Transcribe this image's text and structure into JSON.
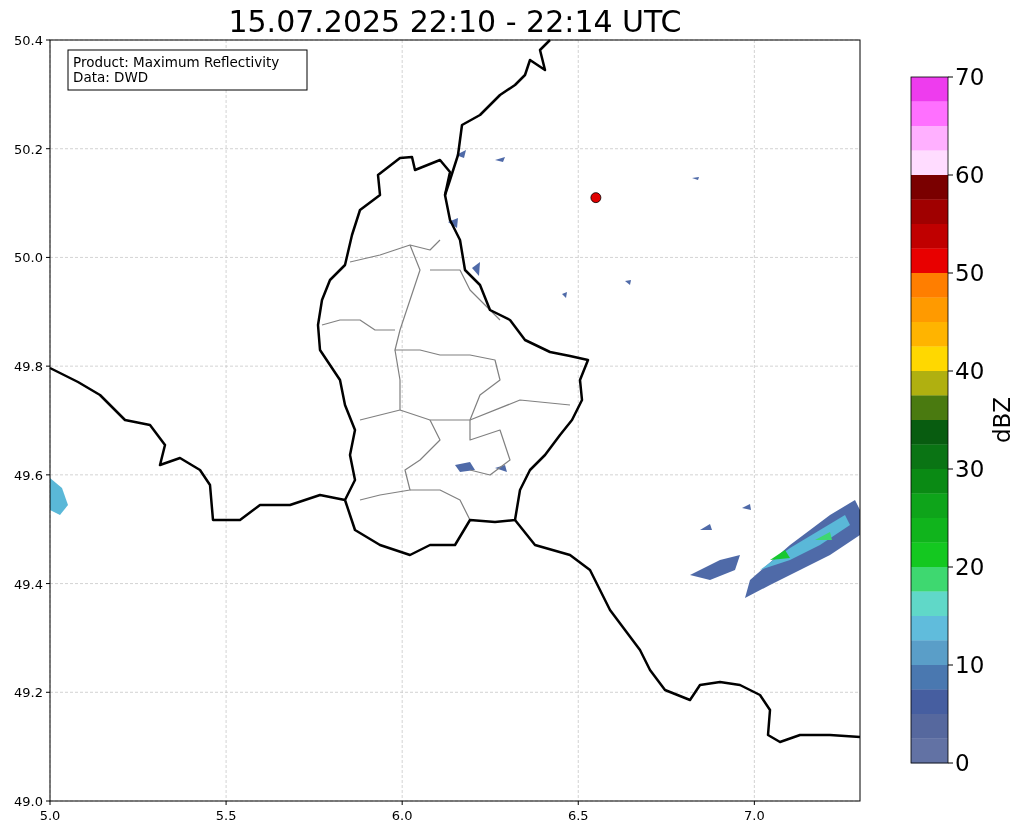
{
  "title": "15.07.2025 22:10 - 22:14 UTC",
  "info_box": {
    "lines": [
      "Product: Maximum Reflectivity",
      "Data: DWD"
    ]
  },
  "map": {
    "chart_data": {
      "type": "scatter",
      "grid": true,
      "xlim": [
        5.0,
        7.3
      ],
      "ylim": [
        49.0,
        50.4
      ],
      "xticks": [
        {
          "value": 5.0,
          "label": "5.0"
        },
        {
          "value": 5.5,
          "label": "5.5"
        },
        {
          "value": 6.0,
          "label": "6.0"
        },
        {
          "value": 6.5,
          "label": "6.5"
        },
        {
          "value": 7.0,
          "label": "7.0"
        }
      ],
      "yticks": [
        {
          "value": 49.0,
          "label": "49.0"
        },
        {
          "value": 49.2,
          "label": "49.2"
        },
        {
          "value": 49.4,
          "label": "49.4"
        },
        {
          "value": 49.6,
          "label": "49.6"
        },
        {
          "value": 49.8,
          "label": "49.8"
        },
        {
          "value": 50.0,
          "label": "50.0"
        },
        {
          "value": 50.2,
          "label": "50.2"
        },
        {
          "value": 50.4,
          "label": "50.4"
        }
      ],
      "x": [
        6.55
      ],
      "series": [
        {
          "color": "#e00000",
          "values": [
            50.11
          ]
        }
      ]
    }
  },
  "colorbar": {
    "label": "dBZ",
    "ticks": [
      "70",
      "60",
      "50",
      "40",
      "30",
      "20",
      "10",
      "0"
    ],
    "bands": [
      {
        "color": "#ee3cee"
      },
      {
        "color": "#ff70ff"
      },
      {
        "color": "#ffb0ff"
      },
      {
        "color": "#ffdcff"
      },
      {
        "color": "#7a0000"
      },
      {
        "color": "#a00000"
      },
      {
        "color": "#c00000"
      },
      {
        "color": "#e80000"
      },
      {
        "color": "#ff7e00"
      },
      {
        "color": "#ff9a00"
      },
      {
        "color": "#ffb400"
      },
      {
        "color": "#ffd800"
      },
      {
        "color": "#b0b010"
      },
      {
        "color": "#4a7a10"
      },
      {
        "color": "#085c10"
      },
      {
        "color": "#0a7414"
      },
      {
        "color": "#0a8a14"
      },
      {
        "color": "#0ea41a"
      },
      {
        "color": "#10b41c"
      },
      {
        "color": "#14c820"
      },
      {
        "color": "#3ed870"
      },
      {
        "color": "#60d8c8"
      },
      {
        "color": "#60bcdc"
      },
      {
        "color": "#5a9ec8"
      },
      {
        "color": "#4a78b0"
      },
      {
        "color": "#465ea0"
      },
      {
        "color": "#56689e"
      },
      {
        "color": "#6272a4"
      }
    ]
  }
}
